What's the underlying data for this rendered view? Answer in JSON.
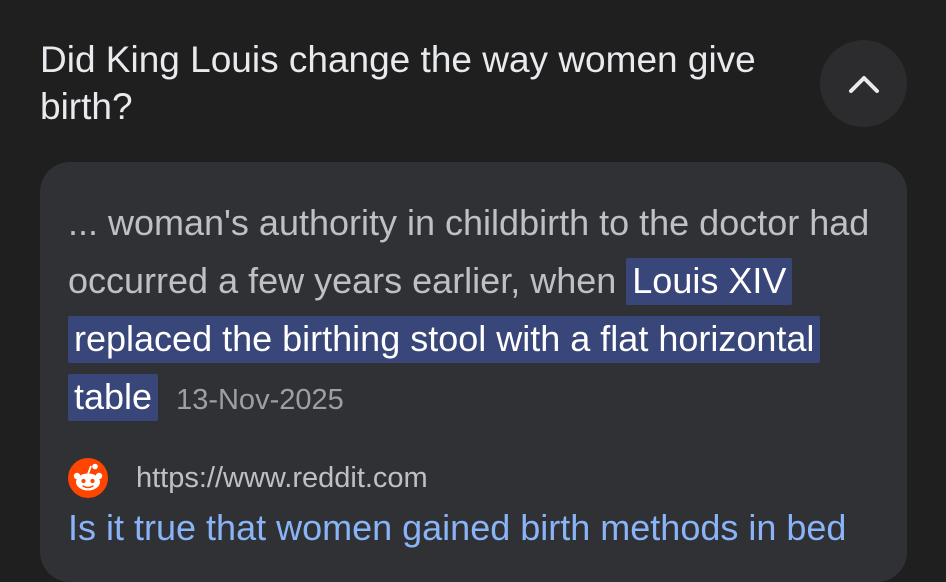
{
  "question": {
    "text": "Did King Louis change the way women give birth?"
  },
  "collapse_button": {
    "icon": "chevron-up-icon"
  },
  "answer": {
    "snippet_lead": "... woman's authority in childbirth to the doctor had occurred a few years earlier, when",
    "snippet_highlight": "Louis XIV replaced the birthing stool with a flat horizontal table",
    "date": "13-Nov-2025",
    "source_icon": "reddit-icon",
    "source_url": "https://www.reddit.com",
    "next_link_partial": "Is it true that women gained birth methods in bed"
  },
  "colors": {
    "background": "#1f1f1f",
    "card": "#303134",
    "highlight": "#394679",
    "link": "#8ab4f8",
    "reddit": "#ff4500"
  }
}
